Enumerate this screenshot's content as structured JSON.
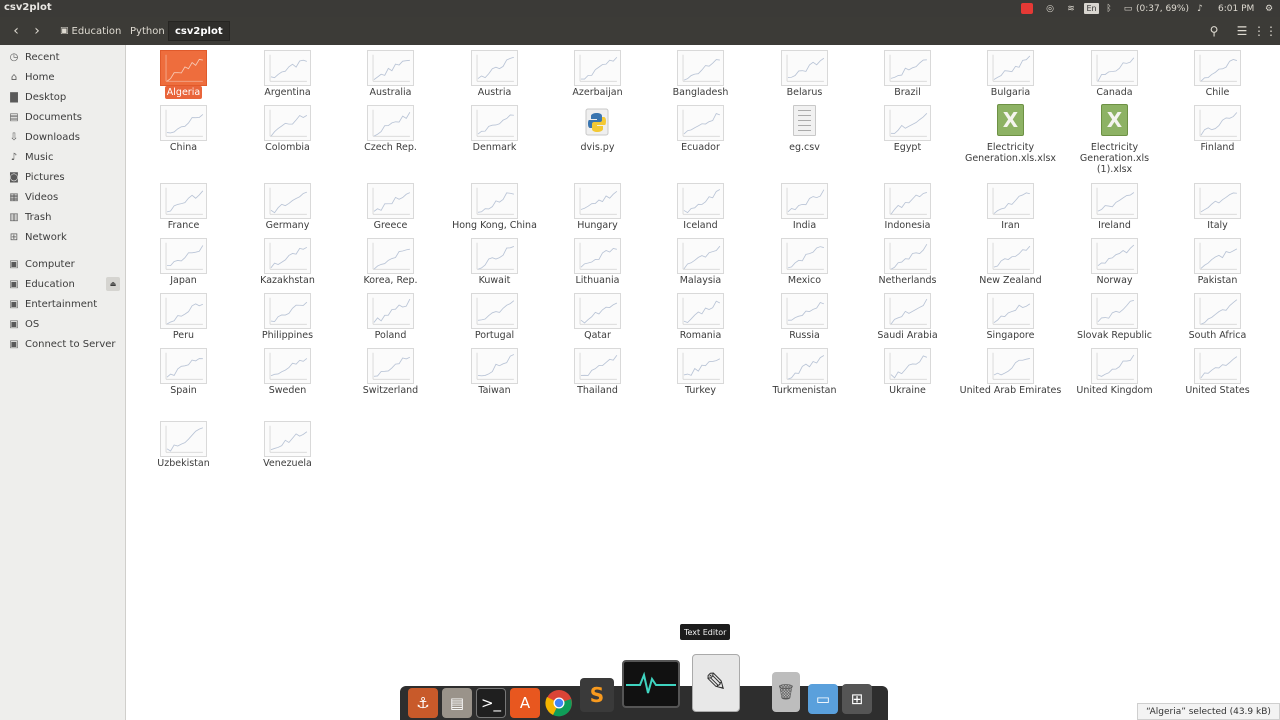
{
  "window": {
    "title": "csv2plot"
  },
  "top_panel": {
    "battery": "(0:37, 69%)",
    "clock": "6:01 PM",
    "keyboard_layout": "En"
  },
  "header": {
    "breadcrumb": [
      "Education",
      "Python",
      "csv2plot"
    ]
  },
  "sidebar": {
    "places": [
      {
        "label": "Recent",
        "icon": "clock-icon"
      },
      {
        "label": "Home",
        "icon": "home-icon"
      },
      {
        "label": "Desktop",
        "icon": "folder-icon"
      },
      {
        "label": "Documents",
        "icon": "document-icon"
      },
      {
        "label": "Downloads",
        "icon": "download-icon"
      },
      {
        "label": "Music",
        "icon": "music-icon"
      },
      {
        "label": "Pictures",
        "icon": "camera-icon"
      },
      {
        "label": "Videos",
        "icon": "film-icon"
      },
      {
        "label": "Trash",
        "icon": "trash-icon"
      },
      {
        "label": "Network",
        "icon": "network-icon"
      }
    ],
    "devices": [
      {
        "label": "Computer",
        "icon": "drive-icon"
      },
      {
        "label": "Education",
        "icon": "drive-icon"
      },
      {
        "label": "Entertainment",
        "icon": "drive-icon"
      },
      {
        "label": "OS",
        "icon": "drive-icon"
      },
      {
        "label": "Connect to Server",
        "icon": "server-icon"
      }
    ]
  },
  "files": [
    {
      "name": "Algeria",
      "type": "image",
      "selected": true
    },
    {
      "name": "Argentina",
      "type": "image"
    },
    {
      "name": "Australia",
      "type": "image"
    },
    {
      "name": "Austria",
      "type": "image"
    },
    {
      "name": "Azerbaijan",
      "type": "image"
    },
    {
      "name": "Bangladesh",
      "type": "image"
    },
    {
      "name": "Belarus",
      "type": "image"
    },
    {
      "name": "Brazil",
      "type": "image"
    },
    {
      "name": "Bulgaria",
      "type": "image"
    },
    {
      "name": "Canada",
      "type": "image"
    },
    {
      "name": "Chile",
      "type": "image"
    },
    {
      "name": "China",
      "type": "image"
    },
    {
      "name": "Colombia",
      "type": "image"
    },
    {
      "name": "Czech Rep.",
      "type": "image"
    },
    {
      "name": "Denmark",
      "type": "image"
    },
    {
      "name": "dvis.py",
      "type": "python"
    },
    {
      "name": "Ecuador",
      "type": "image"
    },
    {
      "name": "eg.csv",
      "type": "text"
    },
    {
      "name": "Egypt",
      "type": "image"
    },
    {
      "name": "Electricity Generation.xls.xlsx",
      "type": "spreadsheet"
    },
    {
      "name": "Electricity Generation.xls (1).xlsx",
      "type": "spreadsheet"
    },
    {
      "name": "Finland",
      "type": "image"
    },
    {
      "name": "France",
      "type": "image"
    },
    {
      "name": "Germany",
      "type": "image"
    },
    {
      "name": "Greece",
      "type": "image"
    },
    {
      "name": "Hong Kong, China",
      "type": "image"
    },
    {
      "name": "Hungary",
      "type": "image"
    },
    {
      "name": "Iceland",
      "type": "image"
    },
    {
      "name": "India",
      "type": "image"
    },
    {
      "name": "Indonesia",
      "type": "image"
    },
    {
      "name": "Iran",
      "type": "image"
    },
    {
      "name": "Ireland",
      "type": "image"
    },
    {
      "name": "Italy",
      "type": "image"
    },
    {
      "name": "Japan",
      "type": "image"
    },
    {
      "name": "Kazakhstan",
      "type": "image"
    },
    {
      "name": "Korea, Rep.",
      "type": "image"
    },
    {
      "name": "Kuwait",
      "type": "image"
    },
    {
      "name": "Lithuania",
      "type": "image"
    },
    {
      "name": "Malaysia",
      "type": "image"
    },
    {
      "name": "Mexico",
      "type": "image"
    },
    {
      "name": "Netherlands",
      "type": "image"
    },
    {
      "name": "New Zealand",
      "type": "image"
    },
    {
      "name": "Norway",
      "type": "image"
    },
    {
      "name": "Pakistan",
      "type": "image"
    },
    {
      "name": "Peru",
      "type": "image"
    },
    {
      "name": "Philippines",
      "type": "image"
    },
    {
      "name": "Poland",
      "type": "image"
    },
    {
      "name": "Portugal",
      "type": "image"
    },
    {
      "name": "Qatar",
      "type": "image"
    },
    {
      "name": "Romania",
      "type": "image"
    },
    {
      "name": "Russia",
      "type": "image"
    },
    {
      "name": "Saudi Arabia",
      "type": "image"
    },
    {
      "name": "Singapore",
      "type": "image"
    },
    {
      "name": "Slovak Republic",
      "type": "image"
    },
    {
      "name": "South Africa",
      "type": "image"
    },
    {
      "name": "Spain",
      "type": "image"
    },
    {
      "name": "Sweden",
      "type": "image"
    },
    {
      "name": "Switzerland",
      "type": "image"
    },
    {
      "name": "Taiwan",
      "type": "image"
    },
    {
      "name": "Thailand",
      "type": "image"
    },
    {
      "name": "Turkey",
      "type": "image"
    },
    {
      "name": "Turkmenistan",
      "type": "image"
    },
    {
      "name": "Ukraine",
      "type": "image"
    },
    {
      "name": "United Arab Emirates",
      "type": "image"
    },
    {
      "name": "United Kingdom",
      "type": "image"
    },
    {
      "name": "United States",
      "type": "image"
    },
    {
      "name": "Uzbekistan",
      "type": "image"
    },
    {
      "name": "Venezuela",
      "type": "image"
    }
  ],
  "dock": {
    "tooltip": "Text Editor",
    "apps": [
      "anchor-icon",
      "file-manager-icon",
      "terminal-icon",
      "software-center-icon",
      "chrome-icon",
      "sublime-text-icon",
      "system-monitor-icon",
      "text-editor-icon",
      "trash-icon",
      "desktop-icon",
      "workspace-switcher-icon"
    ]
  },
  "status": {
    "text": "“Algeria” selected  (43.9 kB)"
  },
  "colors": {
    "selection": "#e9653b",
    "panel": "#3c3b37",
    "sidebar": "#eeeeec"
  }
}
